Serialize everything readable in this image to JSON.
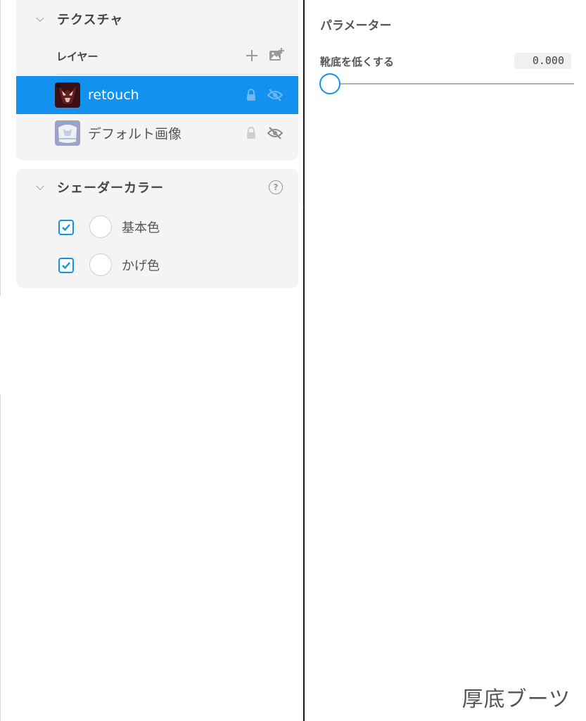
{
  "texture_section": {
    "title": "テクスチャ",
    "layers_title": "レイヤー",
    "layers": [
      {
        "name": "retouch",
        "selected": true,
        "thumb": "dark-mask-thumbnail"
      },
      {
        "name": "デフォルト画像",
        "selected": false,
        "thumb": "white-garment-thumbnail"
      }
    ]
  },
  "shader_section": {
    "title": "シェーダーカラー",
    "colors": [
      {
        "label": "基本色",
        "checked": true,
        "color": "#ffffff"
      },
      {
        "label": "かげ色",
        "checked": true,
        "color": "#ffffff"
      }
    ]
  },
  "parameters": {
    "title": "パラメーター",
    "slider": {
      "label": "靴底を低くする",
      "value": "0.000",
      "level": 0
    }
  },
  "caption": "厚底ブーツ",
  "colors": {
    "accent": "#1292ee",
    "panel_bg": "#f4f4f4"
  }
}
